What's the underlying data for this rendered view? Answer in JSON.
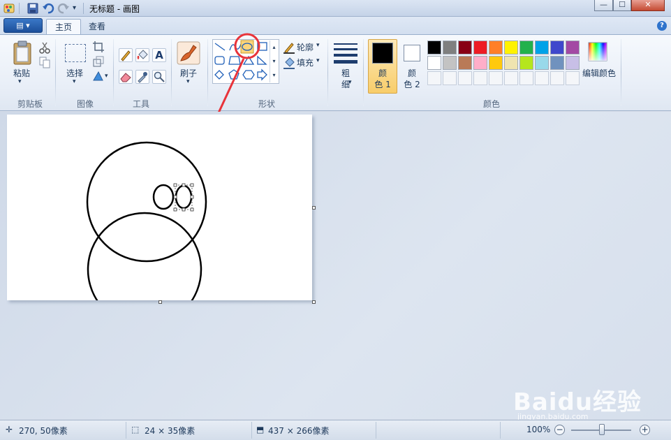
{
  "window": {
    "title": "无标题 - 画图",
    "minimize": "—",
    "maximize": "☐",
    "close": "✕"
  },
  "tabs": {
    "app_menu": "▤ ▾",
    "home": "主页",
    "view": "查看",
    "help": "?"
  },
  "ribbon": {
    "clipboard": {
      "paste": "粘贴",
      "group": "剪贴板"
    },
    "image": {
      "select": "选择",
      "group": "图像"
    },
    "tools": {
      "text_glyph": "A",
      "group": "工具"
    },
    "brushes": {
      "label": "刷子"
    },
    "shapes": {
      "outline": "轮廓",
      "fill": "填充",
      "group": "形状"
    },
    "size": {
      "line1": "粗",
      "line2": "细"
    },
    "colors": {
      "color1_line1": "颜",
      "color1_line2": "色 1",
      "color2_line1": "颜",
      "color2_line2": "色 2",
      "edit": "编辑颜色",
      "group": "颜色",
      "color1_value": "#000000",
      "color2_value": "#ffffff",
      "palette_row1": [
        "#000000",
        "#7f7f7f",
        "#880015",
        "#ed1c24",
        "#ff7f27",
        "#fff200",
        "#22b14c",
        "#00a2e8",
        "#3f48cc",
        "#a349a4"
      ],
      "palette_row2": [
        "#ffffff",
        "#c3c3c3",
        "#b97a57",
        "#ffaec9",
        "#ffc90e",
        "#efe4b0",
        "#b5e61d",
        "#99d9ea",
        "#7092be",
        "#c8bfe7"
      ]
    }
  },
  "annotation": {
    "highlight_color": "#e8333a"
  },
  "status": {
    "cursor_pos": "270, 50像素",
    "selection_size": "24 × 35像素",
    "image_size": "437 × 266像素",
    "zoom": "100%",
    "zoom_out": "−",
    "zoom_in": "+"
  },
  "watermark": {
    "text": "Baidu经验",
    "sub": "jingyan.baidu.com"
  }
}
